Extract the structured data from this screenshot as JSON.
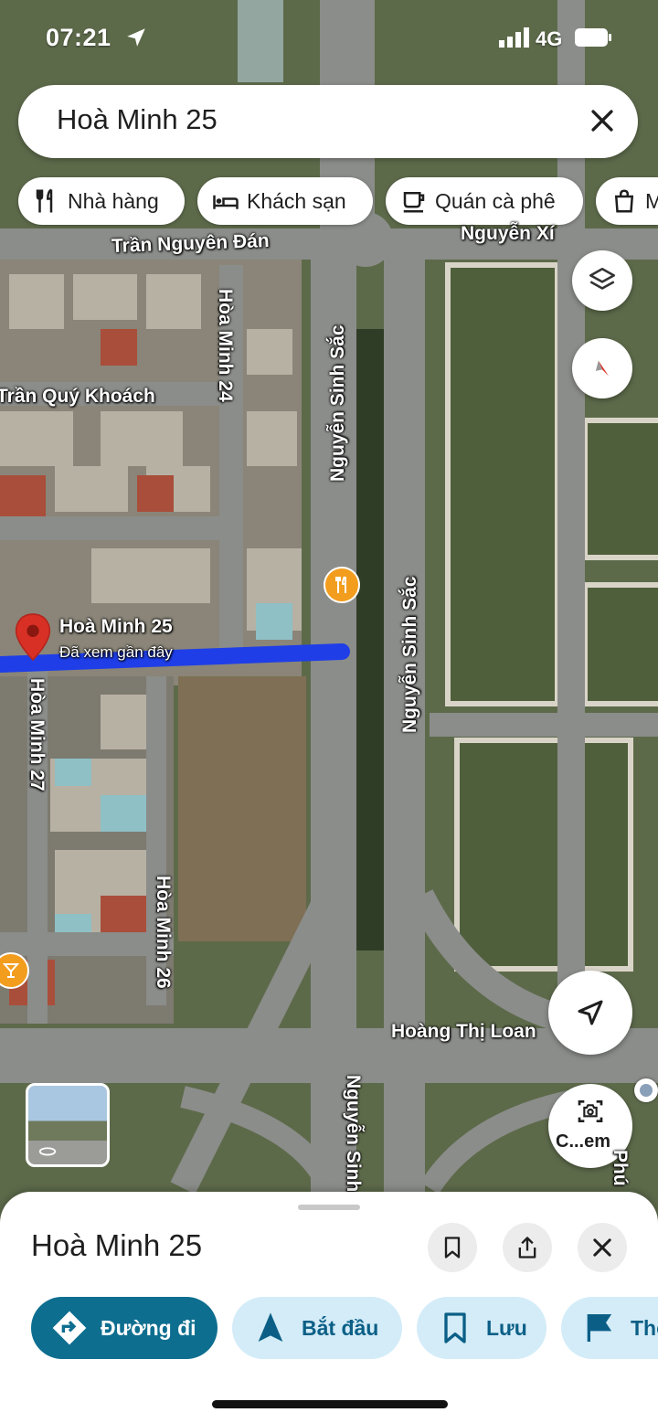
{
  "status_bar": {
    "time": "07:21",
    "network": "4G"
  },
  "search": {
    "query": "Hoà Minh 25"
  },
  "chips": [
    {
      "label": "Nhà hàng",
      "icon": "restaurant-icon"
    },
    {
      "label": "Khách sạn",
      "icon": "hotel-icon"
    },
    {
      "label": "Quán cà phê",
      "icon": "coffee-icon"
    },
    {
      "label": "M",
      "icon": "shopping-icon"
    }
  ],
  "map": {
    "street_labels": [
      "Trần Nguyên Đán",
      "Nguyễn Xí",
      "Hòa Minh 24",
      "Trần Quý Khoách",
      "Nguyễn Sinh Sắc",
      "Nguyễn Sinh Sắc",
      "Hòa Minh 27",
      "Hòa Minh 26",
      "Hoàng Thị Loan",
      "Nguyễn Sinh",
      "Phú"
    ],
    "pin": {
      "title": "Hoà Minh 25",
      "subtitle": "Đã xem gần đây"
    },
    "camera_label": "C...em",
    "colors": {
      "route": "#1f3ee8",
      "pin": "#d93025",
      "poi": "#f29d1e"
    }
  },
  "sheet": {
    "title": "Hoà Minh 25",
    "actions": [
      {
        "label": "Đường đi",
        "icon": "directions-icon"
      },
      {
        "label": "Bắt đầu",
        "icon": "navigation-arrow-icon"
      },
      {
        "label": "Lưu",
        "icon": "bookmark-icon"
      },
      {
        "label": "The",
        "icon": "flag-icon"
      }
    ]
  }
}
